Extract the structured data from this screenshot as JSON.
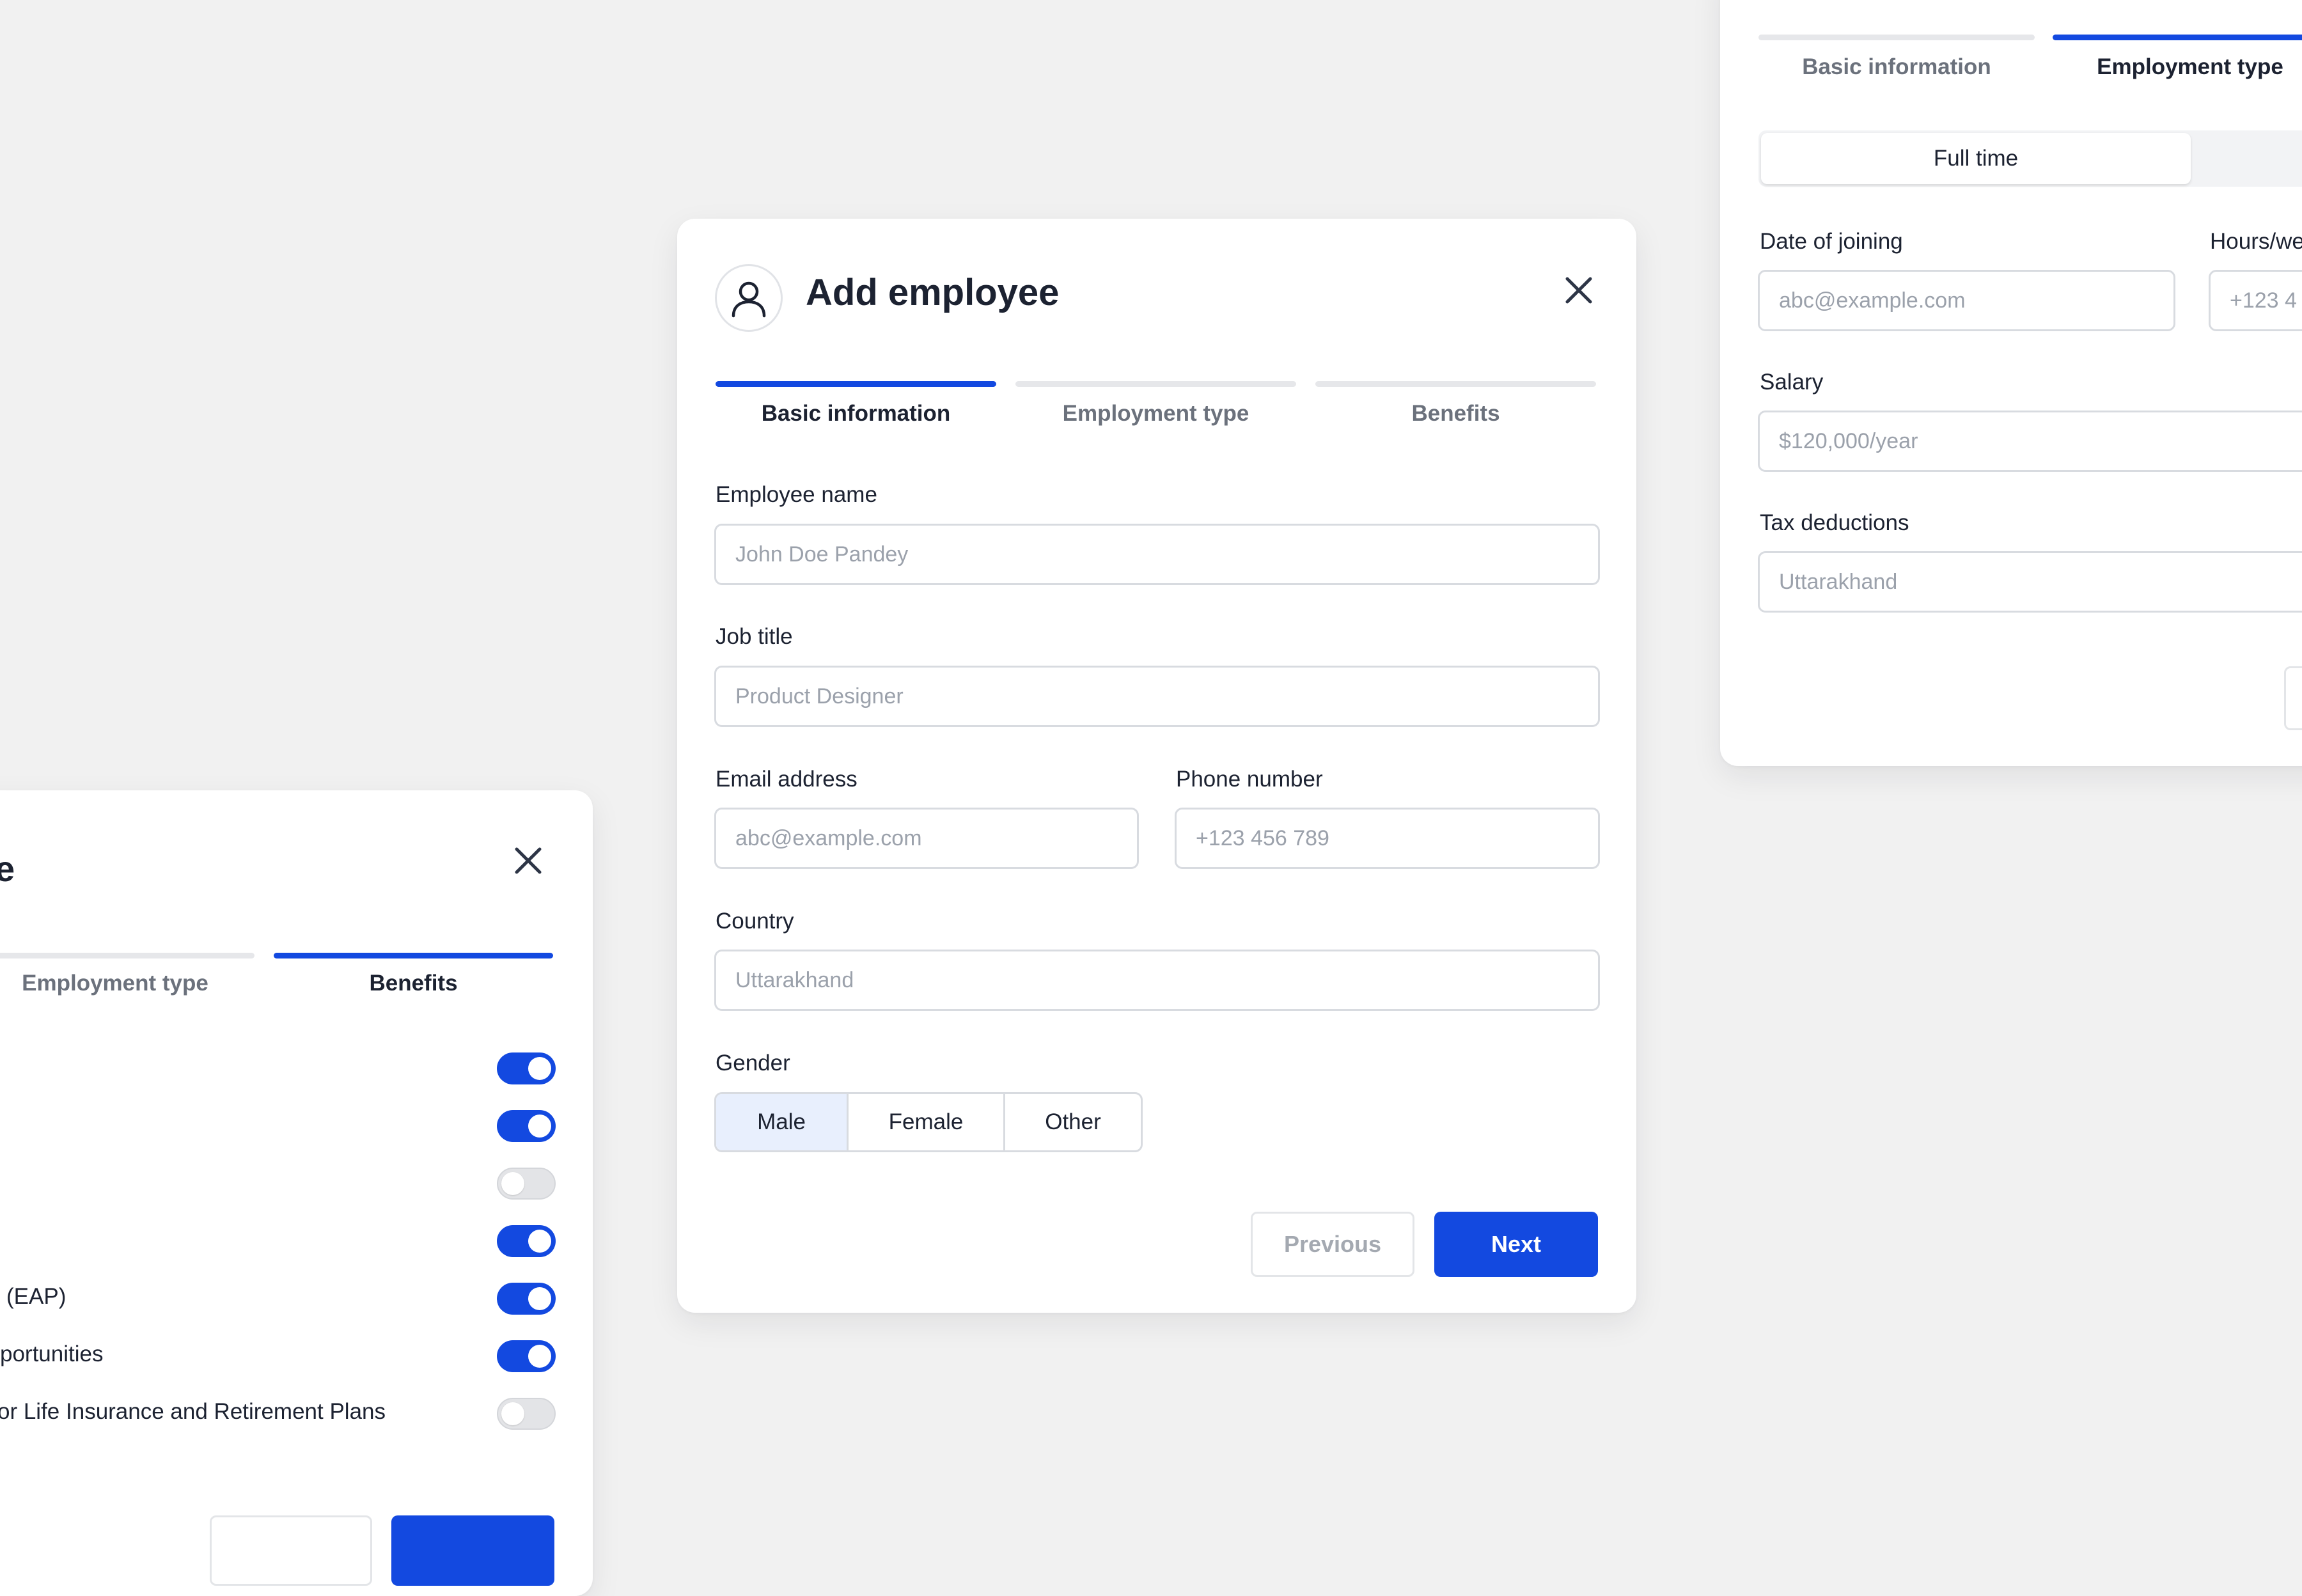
{
  "main_dialog": {
    "title": "Add employee",
    "tabs": [
      {
        "label": "Basic information",
        "active": true
      },
      {
        "label": "Employment type",
        "active": false
      },
      {
        "label": "Benefits",
        "active": false
      }
    ],
    "fields": {
      "employee_name": {
        "label": "Employee name",
        "placeholder": "John Doe Pandey"
      },
      "job_title": {
        "label": "Job title",
        "placeholder": "Product Designer"
      },
      "email": {
        "label": "Email address",
        "placeholder": "abc@example.com"
      },
      "phone": {
        "label": "Phone number",
        "placeholder": "+123 456 789"
      },
      "country": {
        "label": "Country",
        "placeholder": "Uttarakhand"
      }
    },
    "gender": {
      "label": "Gender",
      "options": [
        "Male",
        "Female",
        "Other"
      ],
      "selected": "Male"
    },
    "buttons": {
      "previous": "Previous",
      "next": "Next"
    }
  },
  "left_dialog": {
    "title_fragment": "e",
    "tabs": [
      {
        "label": "Employment type",
        "active": false
      },
      {
        "label": "Benefits",
        "active": true
      }
    ],
    "benefits": [
      {
        "label": "",
        "enabled": true
      },
      {
        "label": "",
        "enabled": true
      },
      {
        "label": "",
        "enabled": false
      },
      {
        "label": "",
        "enabled": true
      },
      {
        "label": "(EAP)",
        "enabled": true
      },
      {
        "label": "portunities",
        "enabled": true
      },
      {
        "label": "or Life Insurance and Retirement Plans",
        "enabled": false
      }
    ]
  },
  "right_dialog": {
    "tabs": [
      {
        "label": "Basic information",
        "active": false
      },
      {
        "label": "Employment type",
        "active": true
      }
    ],
    "employment_type_selected": "Full time",
    "fields": {
      "date_of_joining": {
        "label": "Date of joining",
        "placeholder": "abc@example.com"
      },
      "hours": {
        "label": "Hours/we",
        "placeholder": "+123 4"
      },
      "salary": {
        "label": "Salary",
        "placeholder": "$120,000/year"
      },
      "tax": {
        "label": "Tax deductions",
        "placeholder": "Uttarakhand"
      }
    }
  },
  "colors": {
    "background": "#f1f1f1",
    "accent": "#1349e0",
    "text": "#1c2231",
    "muted_text": "#6b717c",
    "placeholder": "#9ba1ab",
    "selected_segment": "#e8effd"
  }
}
